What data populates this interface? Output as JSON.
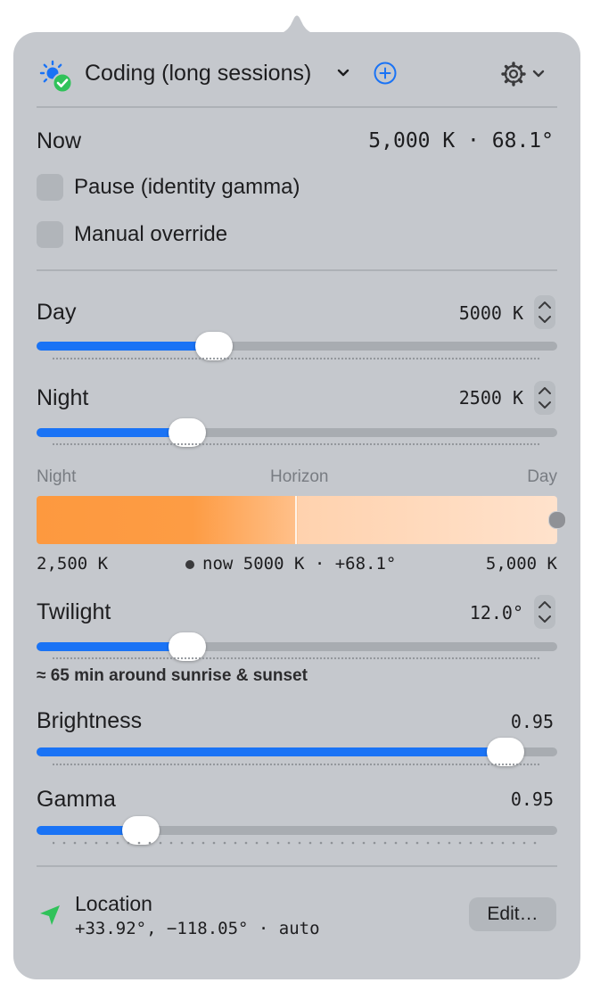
{
  "header": {
    "profile_name": "Coding (long sessions)",
    "icons": [
      "sun-check-icon",
      "chevron-down-icon",
      "plus-circle-icon",
      "gear-icon"
    ]
  },
  "now": {
    "label": "Now",
    "value": "5,000 K · 68.1°"
  },
  "options": {
    "pause_label": "Pause (identity gamma)",
    "manual_label": "Manual override"
  },
  "day": {
    "label": "Day",
    "value": "5000 K",
    "level": 0.34
  },
  "night": {
    "label": "Night",
    "value": "2500 K",
    "level": 0.29
  },
  "gradient": {
    "left_label": "Night",
    "center_label": "Horizon",
    "right_label": "Day",
    "left_value": "2,500 K",
    "now_text": "now 5000 K · +68.1°",
    "right_value": "5,000 K"
  },
  "twilight": {
    "label": "Twilight",
    "value": "12.0°",
    "level": 0.29,
    "hint": "≈ 65 min around sunrise & sunset"
  },
  "brightness": {
    "label": "Brightness",
    "value": "0.95",
    "level": 0.9
  },
  "gamma": {
    "label": "Gamma",
    "value": "0.95",
    "level": 0.2
  },
  "location": {
    "title": "Location",
    "coords": "+33.92°, −118.05° · auto",
    "edit_label": "Edit…"
  },
  "colors": {
    "accent": "#1a73f5",
    "popover_bg": "#c5c8cd",
    "status_green": "#30c25a",
    "gradient_night": "#fd993f",
    "gradient_day": "#ffe2cc"
  }
}
